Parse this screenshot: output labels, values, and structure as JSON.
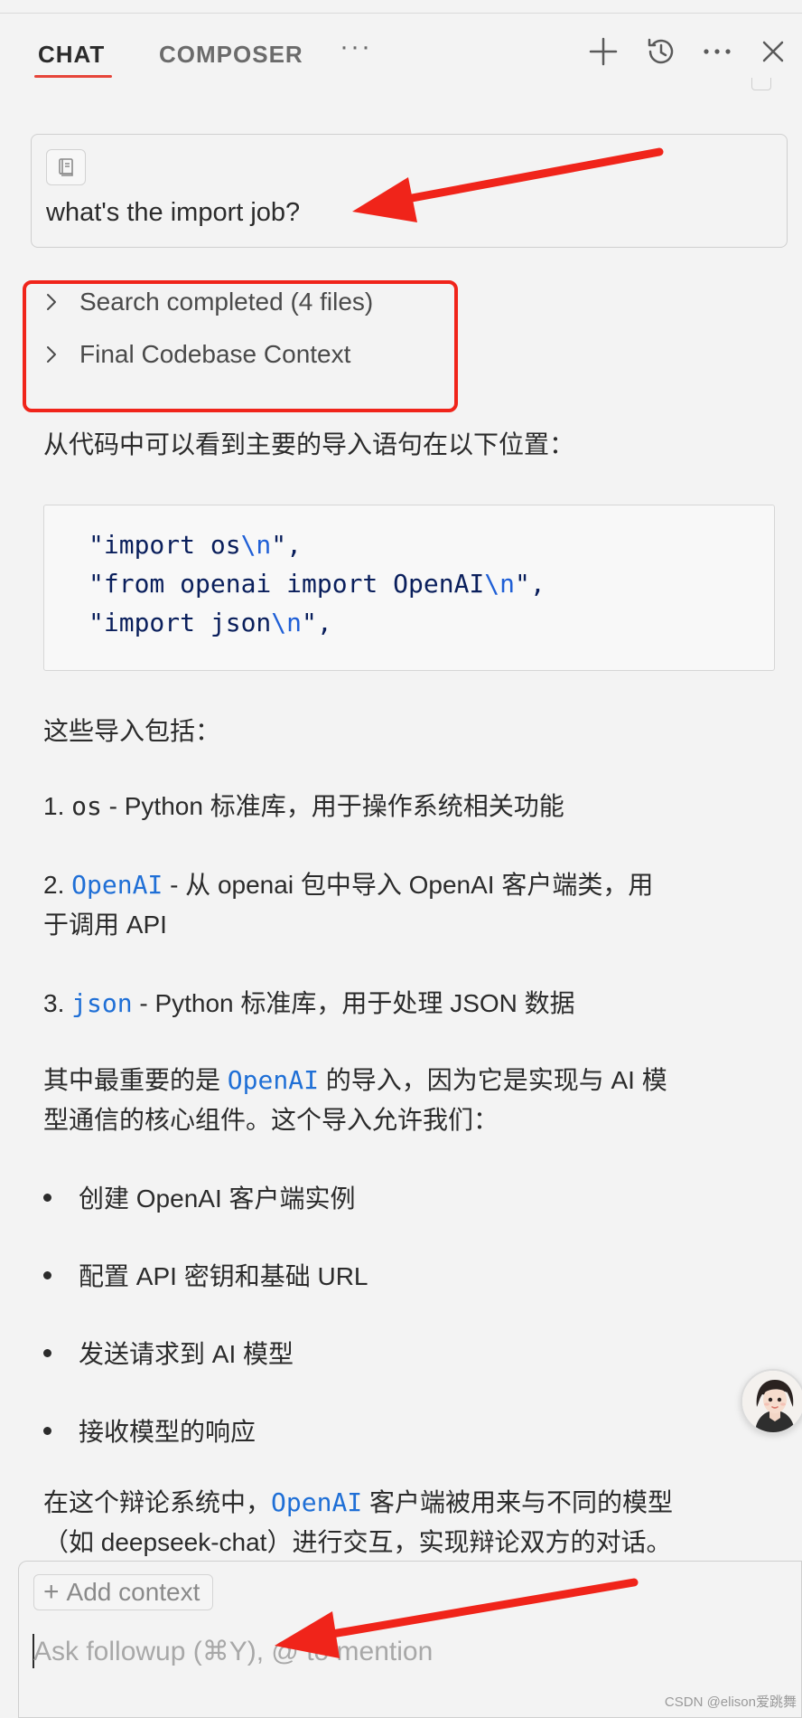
{
  "header": {
    "tabs": [
      {
        "label": "CHAT",
        "active": true
      },
      {
        "label": "COMPOSER",
        "active": false
      }
    ],
    "more_label": "···",
    "actions": [
      "plus-icon",
      "history-icon",
      "more-icon",
      "close-icon"
    ]
  },
  "user_message": {
    "text": "what's the import job?"
  },
  "steps": [
    {
      "label": "Search completed (4 files)"
    },
    {
      "label": "Final Codebase Context"
    }
  ],
  "answer": {
    "intro": "从代码中可以看到主要的导入语句在以下位置：",
    "code_lines": [
      {
        "pre": "\"import os",
        "esc": "\\n",
        "post": "\","
      },
      {
        "pre": "\"from openai import OpenAI",
        "esc": "\\n",
        "post": "\","
      },
      {
        "pre": "\"import json",
        "esc": "\\n",
        "post": "\","
      }
    ],
    "includes_label": "这些导入包括：",
    "items": [
      {
        "num": "1.",
        "code": "os",
        "text": " - Python 标准库，用于操作系统相关功能",
        "cont": ""
      },
      {
        "num": "2.",
        "code": "OpenAI",
        "text": " - 从 openai 包中导入 OpenAI 客户端类，用",
        "cont": "于调用 API"
      },
      {
        "num": "3.",
        "code": "json",
        "text": " - Python 标准库，用于处理 JSON 数据",
        "cont": ""
      }
    ],
    "important_pre": "其中最重要的是 ",
    "important_code": "OpenAI",
    "important_post": " 的导入，因为它是实现与 AI 模",
    "important_cont": "型通信的核心组件。这个导入允许我们：",
    "bullets": [
      "创建 OpenAI 客户端实例",
      "配置 API 密钥和基础 URL",
      "发送请求到 AI 模型",
      "接收模型的响应"
    ],
    "final_pre": "在这个辩论系统中，",
    "final_code": "OpenAI",
    "final_post": " 客户端被用来与不同的模型",
    "final_cont": "（如 deepseek-chat）进行交互，实现辩论双方的对话。"
  },
  "input": {
    "add_context_label": "Add context",
    "placeholder": "Ask followup (⌘Y), @ to mention"
  },
  "watermark": "CSDN @elison爱跳舞",
  "colors": {
    "annotation": "#f0241a",
    "tab_active_underline": "#e6453a",
    "code_link": "#1f6fd6"
  }
}
